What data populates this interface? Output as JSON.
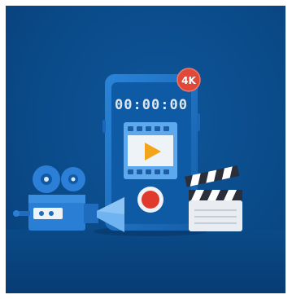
{
  "scene": {
    "timer": "00:00:00",
    "badge": "4K",
    "colors": {
      "background": "#0a4b8a",
      "phone_body": "#1a6fc4",
      "phone_screen": "#0d5aa6",
      "badge": "#e0483a",
      "record_button": "#e03a2e",
      "play_triangle": "#f2a51a",
      "clapper_stripe": "#2a2f3a"
    },
    "icons": [
      "smartphone",
      "film-strip",
      "play-icon",
      "record-button",
      "vintage-movie-camera",
      "clapperboard"
    ]
  }
}
